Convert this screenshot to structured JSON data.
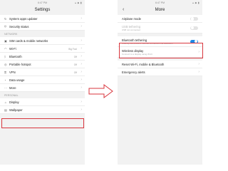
{
  "left_screen": {
    "status_time": "6:47 PM",
    "status_right": "▴ ◆ ▮",
    "title": "Settings",
    "items_top": [
      {
        "label": "System apps updater",
        "icon": "refresh-icon",
        "value": ""
      },
      {
        "label": "Security status",
        "icon": "shield-icon",
        "value": ""
      }
    ],
    "network_header": "NETWORK",
    "network_items": [
      {
        "label": "SIM cards & mobile networks",
        "icon": "sim-card-icon",
        "value": ""
      },
      {
        "label": "Wi-Fi",
        "icon": "wifi-icon",
        "value": "Big Fool"
      },
      {
        "label": "Bluetooth",
        "icon": "bluetooth-icon",
        "value": "Off"
      },
      {
        "label": "Portable hotspot",
        "icon": "hotspot-icon",
        "value": "Off"
      },
      {
        "label": "VPN",
        "icon": "vpn-key-icon",
        "value": "Off"
      },
      {
        "label": "Data usage",
        "icon": "data-usage-icon",
        "value": ""
      },
      {
        "label": "More",
        "icon": "more-dots-icon",
        "value": ""
      }
    ],
    "personal_header": "PERSONAL",
    "personal_items": [
      {
        "label": "Display",
        "icon": "display-icon",
        "value": ""
      },
      {
        "label": "Wallpaper",
        "icon": "wallpaper-icon",
        "value": ""
      }
    ]
  },
  "right_screen": {
    "status_time": "6:47 PM",
    "status_right": "▴ ◆ ▮",
    "back": "‹",
    "title": "More",
    "items": [
      {
        "title": "Airplane mode",
        "subtitle": "",
        "control": "toggle",
        "on": false,
        "dim": false
      },
      {
        "title": "USB tethering",
        "subtitle": "USB not connected",
        "control": "toggle",
        "on": false,
        "dim": true
      },
      {
        "title": "Bluetooth tethering",
        "subtitle": "Sharing this phone's Internet connection via Bluetooth",
        "control": "toggle",
        "on": true,
        "dim": false
      },
      {
        "title": "Wireless display",
        "subtitle": "Connect to a display using Wi-Fi",
        "control": "chevron",
        "on": false,
        "dim": false
      },
      {
        "title": "Reset Wi-Fi, mobile & Bluetooth",
        "subtitle": "",
        "control": "chevron",
        "on": false,
        "dim": false
      },
      {
        "title": "Emergency alerts",
        "subtitle": "",
        "control": "chevron",
        "on": false,
        "dim": false
      }
    ]
  },
  "chevron": "›",
  "colors": {
    "highlight": "#d9363e",
    "toggle_on": "#1e88e5",
    "arrow": "#d9363e"
  }
}
